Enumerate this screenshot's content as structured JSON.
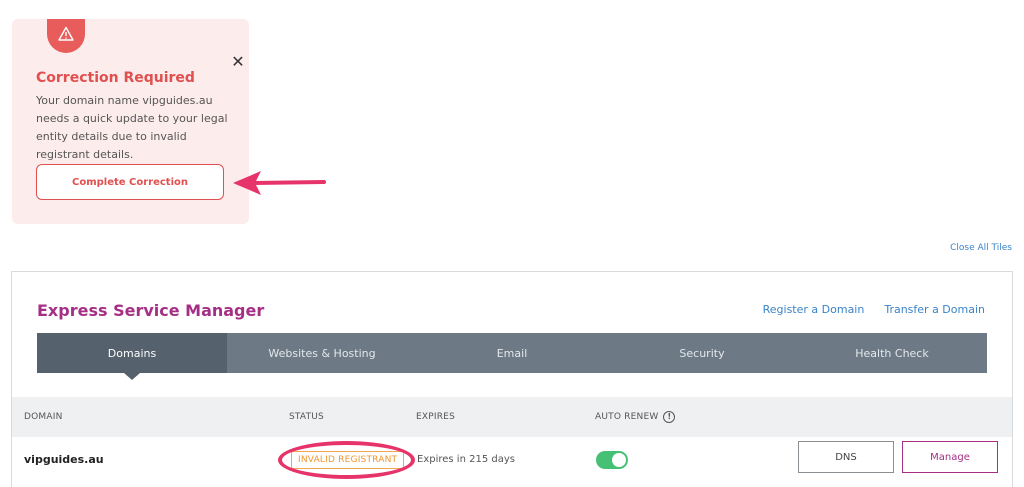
{
  "alert": {
    "icon": "warning-triangle-icon",
    "title": "Correction Required",
    "body": "Your domain name vipguides.au needs a quick update to your legal entity details due to invalid registrant details.",
    "button_label": "Complete Correction",
    "close_icon": "close-icon",
    "colors": {
      "accent": "#e0504f",
      "background": "#fdecec"
    }
  },
  "close_all_label": "Close All Tiles",
  "manager": {
    "title": "Express Service Manager",
    "links": {
      "register": "Register a Domain",
      "transfer": "Transfer a Domain"
    },
    "tabs": [
      {
        "label": "Domains",
        "active": true
      },
      {
        "label": "Websites & Hosting",
        "active": false
      },
      {
        "label": "Email",
        "active": false
      },
      {
        "label": "Security",
        "active": false
      },
      {
        "label": "Health Check",
        "active": false
      }
    ],
    "columns": {
      "domain": "DOMAIN",
      "status": "STATUS",
      "expires": "EXPIRES",
      "auto_renew": "AUTO RENEW"
    },
    "info_icon": "info-icon",
    "rows": [
      {
        "domain": "vipguides.au",
        "status": "INVALID REGISTRANT",
        "expires": "Expires in 215 days",
        "auto_renew": true,
        "dns_label": "DNS",
        "manage_label": "Manage"
      }
    ],
    "colors": {
      "brand": "#a62f86",
      "link": "#3a84c9",
      "status": "#f0962e",
      "toggle_on": "#46c074"
    }
  },
  "annotations": {
    "highlight_color": "#e6346b"
  }
}
